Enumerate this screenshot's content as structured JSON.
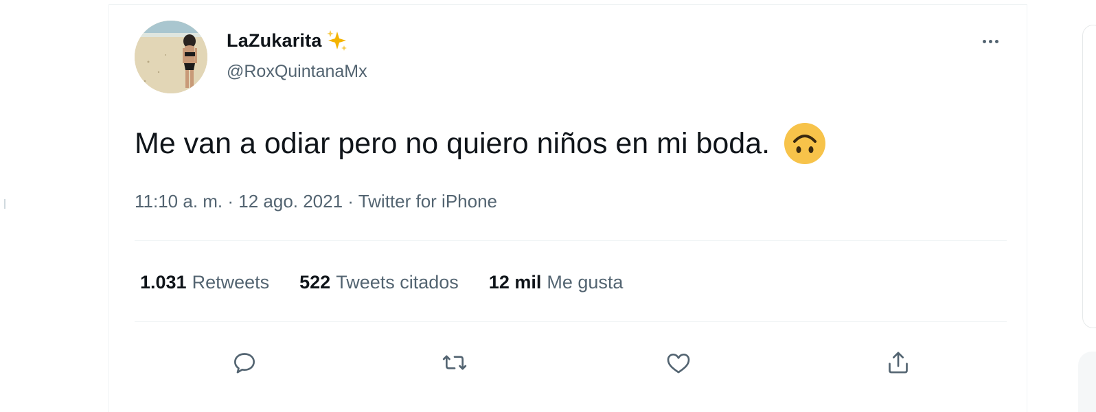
{
  "tweet": {
    "display_name": "LaZukarita",
    "handle": "@RoxQuintanaMx",
    "text": "Me van a odiar pero no quiero niños en mi boda.",
    "meta": "11:10 a. m. · 12 ago. 2021 · Twitter for iPhone",
    "stats": {
      "retweets_count": "1.031",
      "retweets_label": "Retweets",
      "quotes_count": "522",
      "quotes_label": "Tweets citados",
      "likes_count": "12 mil",
      "likes_label": "Me gusta"
    }
  },
  "icons": {
    "name_emoji": "sparkles-icon",
    "text_emoji": "upside-down-face-icon",
    "more": "more-horizontal-icon",
    "reply": "reply-icon",
    "retweet": "retweet-icon",
    "like": "heart-icon",
    "share": "share-icon"
  },
  "colors": {
    "text_primary": "#0f1419",
    "text_secondary": "#536471",
    "divider": "#eff3f4",
    "sparkle": "#f4b400",
    "emoji": "#f7c34a"
  }
}
